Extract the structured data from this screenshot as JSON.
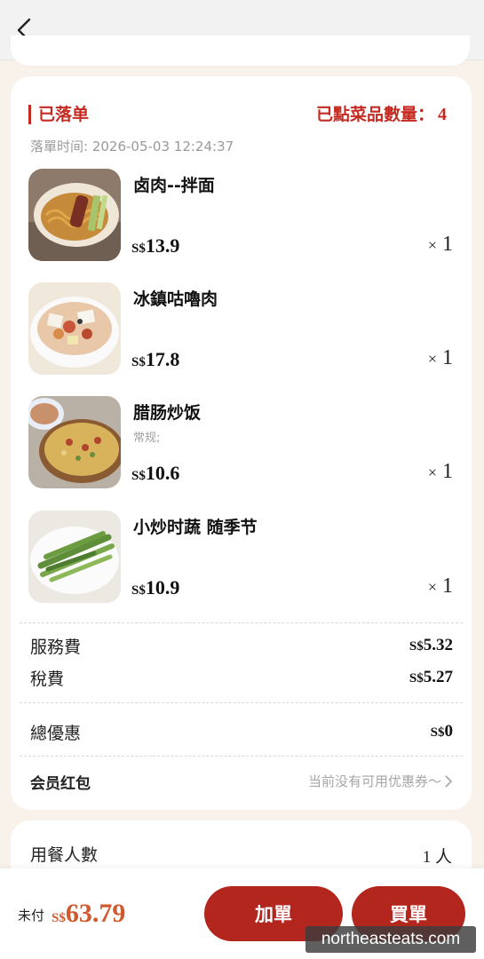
{
  "header": {
    "back_icon": "chevron-left-icon"
  },
  "order": {
    "status": "已落单",
    "count_label": "已點菜品數量：",
    "count_value": "4",
    "time_label": "落單时间:",
    "time_value": "2026-05-03 12:24:37"
  },
  "items": [
    {
      "name": "卤肉--拌面",
      "sub": "",
      "currency": "S$",
      "price": "13.9",
      "qty_sign": "×",
      "qty": "1"
    },
    {
      "name": "冰鎮咕嚕肉",
      "sub": "",
      "currency": "S$",
      "price": "17.8",
      "qty_sign": "×",
      "qty": "1"
    },
    {
      "name": "腊肠炒饭",
      "sub": "常规;",
      "currency": "S$",
      "price": "10.6",
      "qty_sign": "×",
      "qty": "1"
    },
    {
      "name": "小炒时蔬 随季节",
      "sub": "",
      "currency": "S$",
      "price": "10.9",
      "qty_sign": "×",
      "qty": "1"
    }
  ],
  "fees": {
    "service_label": "服務費",
    "service_currency": "S$",
    "service_value": "5.32",
    "tax_label": "稅費",
    "tax_currency": "S$",
    "tax_value": "5.27",
    "discount_label": "總優惠",
    "discount_currency": "S$",
    "discount_value": "0",
    "coupon_label": "会员红包",
    "coupon_value": "当前没有可用优惠券～"
  },
  "diners": {
    "label": "用餐人數",
    "value": "1 人"
  },
  "footer": {
    "unpaid_label": "未付",
    "currency": "S$",
    "total": "63.79",
    "add_button": "加單",
    "buy_button": "買單"
  },
  "watermark": "northeasteats.com",
  "colors": {
    "accent": "#c42a21",
    "button": "#b3261e",
    "total": "#d05a30",
    "background": "#f8f2ea"
  }
}
